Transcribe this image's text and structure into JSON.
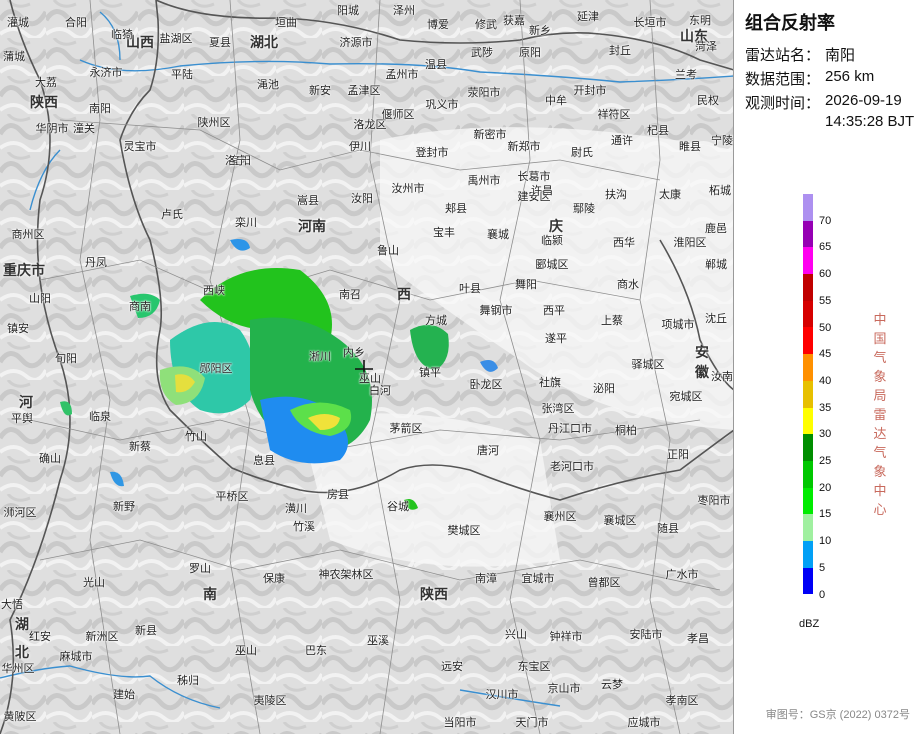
{
  "product": {
    "title": "组合反射率",
    "station_label": "雷达站名：",
    "station_value": "南阳",
    "range_label": "数据范围：",
    "range_value": "256 km",
    "time_label": "观测时间：",
    "time_date": "2026-09-19",
    "time_clock": "14:35:28 BJT"
  },
  "legend": {
    "unit": "dBZ",
    "ticks": [
      "70",
      "65",
      "60",
      "55",
      "50",
      "45",
      "40",
      "35",
      "30",
      "25",
      "20",
      "15",
      "10",
      "5",
      "0"
    ],
    "colors": [
      "#ad90f0",
      "#9600b4",
      "#ff00f0",
      "#c00000",
      "#d60000",
      "#ff0000",
      "#ff9000",
      "#e7c000",
      "#ffff00",
      "#008e00",
      "#00c800",
      "#00ec00",
      "#a0f0a0",
      "#01a0f6",
      "#0000f6"
    ]
  },
  "source": "中国气象局雷达气象中心",
  "review_number": "审图号：GS京 (2022) 0372号",
  "regions": [
    "山西",
    "山东",
    "陕西",
    "河南",
    "安徽",
    "湖北",
    "重庆市",
    "西",
    "河",
    "南",
    "陕西",
    "湖",
    "北",
    "庆"
  ],
  "places": [
    "灌城",
    "合阳",
    "临猗",
    "盐湖区",
    "夏县",
    "垣曲",
    "阳城",
    "济源市",
    "泽州",
    "博爱",
    "修武",
    "获嘉",
    "新乡",
    "延津",
    "长垣市",
    "东明",
    "菏泽",
    "蒲城",
    "大荔",
    "永济市",
    "平陆",
    "渑池",
    "新安",
    "孟津区",
    "孟州市",
    "温县",
    "武陟",
    "原阳",
    "封丘",
    "兰考",
    "华阴市",
    "潼关",
    "陕州区",
    "洛龙区",
    "偃师区",
    "巩义市",
    "荥阳市",
    "中牟",
    "开封市",
    "祥符区",
    "杞县",
    "民权",
    "宁陵",
    "灵宝市",
    "宜阳",
    "伊川",
    "登封市",
    "新密市",
    "新郑市",
    "尉氏",
    "通许",
    "睢县",
    "洛宁",
    "汝州市",
    "禹州市",
    "长葛市",
    "建安区",
    "扶沟",
    "太康",
    "柘城",
    "卢氏",
    "栾川",
    "嵩县",
    "汝阳",
    "郏县",
    "许昌",
    "鄢陵",
    "西华",
    "淮阳区",
    "鹿邑",
    "商州区",
    "丹凤",
    "宝丰",
    "襄城",
    "临颍",
    "郾城区",
    "商水",
    "郸城",
    "山阳",
    "鲁山",
    "叶县",
    "舞阳",
    "西平",
    "上蔡",
    "项城市",
    "沈丘",
    "镇安",
    "商南",
    "西峡",
    "南召",
    "方城",
    "舞钢市",
    "遂平",
    "旬阳",
    "郧阳区",
    "淅川",
    "内乡",
    "镇平",
    "卧龙区",
    "社旗",
    "泌阳",
    "驿城区",
    "汝南",
    "平舆",
    "临泉",
    "白河",
    "张湾区",
    "宛城区",
    "确山",
    "新蔡",
    "竹山",
    "茅箭区",
    "丹江口市",
    "唐河",
    "桐柏",
    "正阳",
    "息县",
    "老河口市",
    "新野",
    "平桥区",
    "房县",
    "谷城",
    "襄州区",
    "枣阳市",
    "浉河区",
    "潢川",
    "竹溪",
    "樊城区",
    "襄城区",
    "随县",
    "罗山",
    "光山",
    "保康",
    "神农架林区",
    "南漳",
    "宜城市",
    "曾都区",
    "广水市",
    "大悟",
    "新县",
    "巫溪",
    "兴山",
    "钟祥市",
    "安陆市",
    "孝昌",
    "红安",
    "麻城市",
    "巫山",
    "巴东",
    "远安",
    "东宝区",
    "京山市",
    "云梦",
    "孝南区",
    "黄陂区",
    "建始",
    "秭归",
    "夷陵区",
    "当阳市",
    "天门市",
    "汉川市",
    "应城市",
    "新洲区",
    "巫山",
    "南阳",
    "华州区",
    "重庆"
  ]
}
